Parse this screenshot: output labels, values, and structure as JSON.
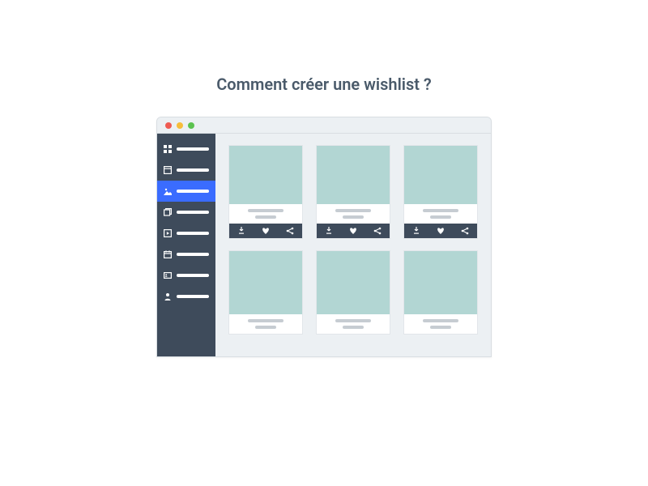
{
  "heading": "Comment créer une wishlist ?",
  "window": {
    "traffic_lights": [
      "red",
      "yellow",
      "green"
    ]
  },
  "sidebar": {
    "items": [
      {
        "icon": "grid-icon",
        "active": false
      },
      {
        "icon": "panel-icon",
        "active": false
      },
      {
        "icon": "image-icon",
        "active": true
      },
      {
        "icon": "gallery-icon",
        "active": false
      },
      {
        "icon": "play-icon",
        "active": false
      },
      {
        "icon": "calendar-icon",
        "active": false
      },
      {
        "icon": "id-card-icon",
        "active": false
      },
      {
        "icon": "user-icon",
        "active": false
      }
    ]
  },
  "grid": {
    "rows": [
      {
        "cards": [
          {
            "actions": true
          },
          {
            "actions": true
          },
          {
            "actions": true
          }
        ]
      },
      {
        "cards": [
          {
            "actions": false
          },
          {
            "actions": false
          },
          {
            "actions": false
          }
        ]
      }
    ],
    "card_actions": [
      "download",
      "favorite",
      "share"
    ]
  }
}
